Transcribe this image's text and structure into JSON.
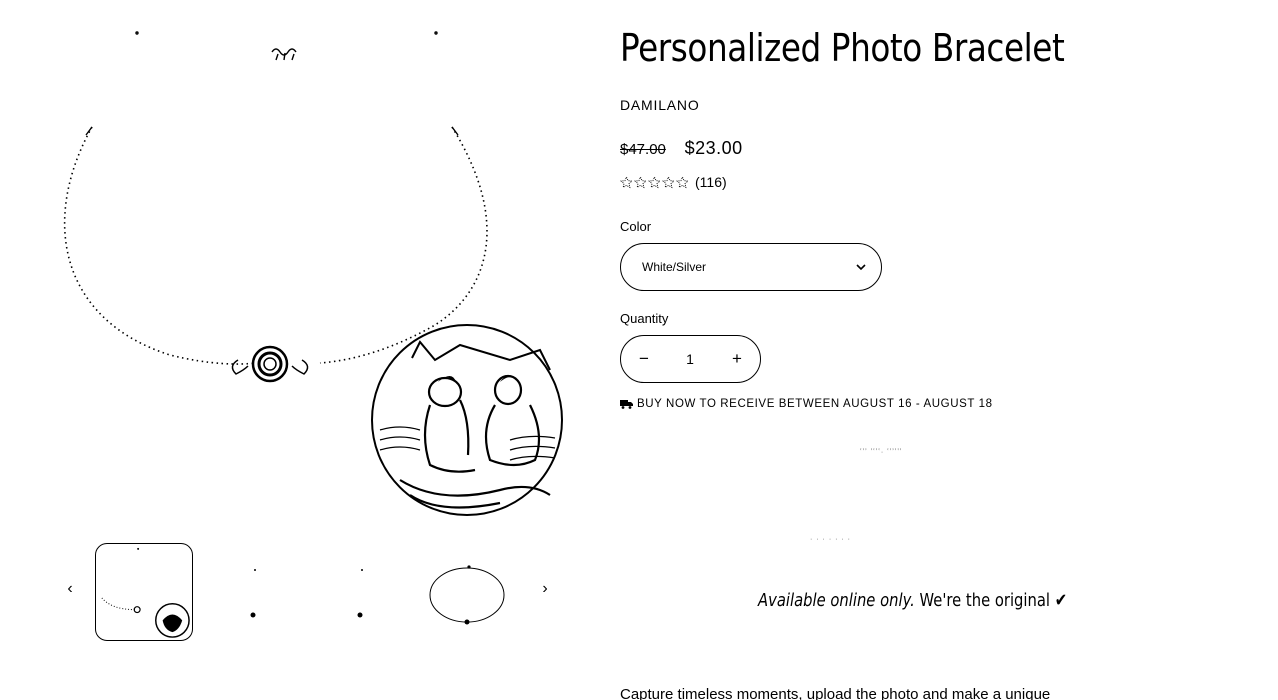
{
  "product": {
    "title": "Personalized Photo Bracelet",
    "vendor": "DAMILANO",
    "price_compare": "$47.00",
    "price_sale": "$23.00",
    "rating_count": "(116)",
    "rating_stars": 5
  },
  "options": {
    "color_label": "Color",
    "color_value": "White/Silver",
    "quantity_label": "Quantity",
    "quantity_value": "1",
    "minus_label": "−",
    "plus_label": "+"
  },
  "shipping": {
    "text": "BUY NOW TO RECEIVE BETWEEN AUGUST 16 - AUGUST 18",
    "icon": "truck-icon"
  },
  "faint_text": {
    "line_a": "ʽʽʼ ʽʽʼʽ· ʽʽʼʽʽʼ",
    "line_b": "· · · · · · ·"
  },
  "tagline": {
    "italic": "Available online only.",
    "rest": " We're the original ✔"
  },
  "description": {
    "text": "Capture timeless moments, upload the photo and make a unique"
  },
  "gallery": {
    "prev_icon": "‹",
    "next_icon": "›"
  },
  "colors": {
    "ink": "#000000",
    "background": "#ffffff"
  }
}
